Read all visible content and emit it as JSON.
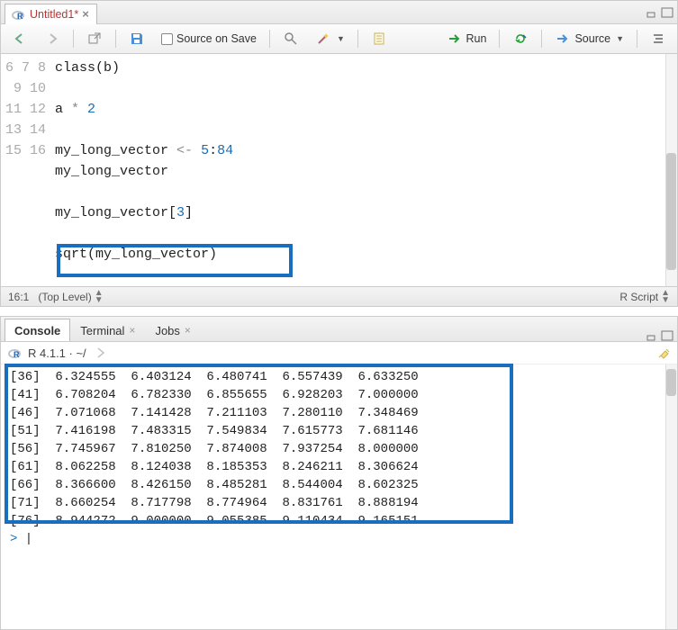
{
  "source_pane": {
    "tab": {
      "title": "Untitled1*",
      "modified": true
    },
    "toolbar": {
      "source_on_save": "Source on Save",
      "run": "Run",
      "source_btn": "Source"
    },
    "cursor_pos": "16:1",
    "scope": "(Top Level)",
    "lang": "R Script",
    "lines": [
      {
        "n": 6,
        "text": "class(b)"
      },
      {
        "n": 7,
        "text": ""
      },
      {
        "n": 8,
        "text": "a * 2"
      },
      {
        "n": 9,
        "text": ""
      },
      {
        "n": 10,
        "text": "my_long_vector <- 5:84"
      },
      {
        "n": 11,
        "text": "my_long_vector"
      },
      {
        "n": 12,
        "text": ""
      },
      {
        "n": 13,
        "text": "my_long_vector[3]"
      },
      {
        "n": 14,
        "text": ""
      },
      {
        "n": 15,
        "text": "sqrt(my_long_vector)"
      },
      {
        "n": 16,
        "text": ""
      }
    ]
  },
  "console_pane": {
    "tabs": {
      "console": "Console",
      "terminal": "Terminal",
      "jobs": "Jobs"
    },
    "header": "R 4.1.1 · ~/",
    "output": [
      "[36]  6.324555  6.403124  6.480741  6.557439  6.633250",
      "[41]  6.708204  6.782330  6.855655  6.928203  7.000000",
      "[46]  7.071068  7.141428  7.211103  7.280110  7.348469",
      "[51]  7.416198  7.483315  7.549834  7.615773  7.681146",
      "[56]  7.745967  7.810250  7.874008  7.937254  8.000000",
      "[61]  8.062258  8.124038  8.185353  8.246211  8.306624",
      "[66]  8.366600  8.426150  8.485281  8.544004  8.602325",
      "[71]  8.660254  8.717798  8.774964  8.831761  8.888194",
      "[76]  8.944272  9.000000  9.055385  9.110434  9.165151"
    ],
    "prompt_char": ">"
  },
  "marks": {
    "editor_highlight_line": 15
  }
}
